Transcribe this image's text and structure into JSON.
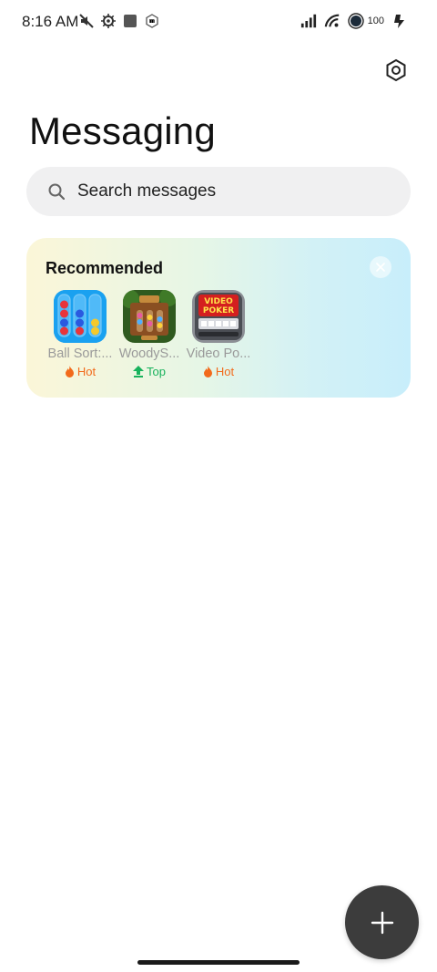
{
  "status_bar": {
    "time": "8:16 AM",
    "battery": "100",
    "icons": [
      "mute-icon",
      "gear-icon",
      "square-icon",
      "mi-icon",
      "signal-icon",
      "wifi-icon",
      "circle-icon",
      "battery-icon"
    ]
  },
  "header": {
    "title": "Messaging",
    "settings_icon": "settings-icon"
  },
  "search": {
    "placeholder": "Search messages"
  },
  "recommended": {
    "title": "Recommended",
    "apps": [
      {
        "name": "Ball Sort:...",
        "badge": "Hot",
        "badge_type": "hot"
      },
      {
        "name": "WoodyS...",
        "badge": "Top",
        "badge_type": "top"
      },
      {
        "name": "Video Po...",
        "badge": "Hot",
        "badge_type": "hot"
      }
    ]
  },
  "fab": {
    "icon": "plus-icon"
  },
  "colors": {
    "fab": "#3c3c3c",
    "hot": "#f26a1b",
    "top": "#18b25c"
  }
}
